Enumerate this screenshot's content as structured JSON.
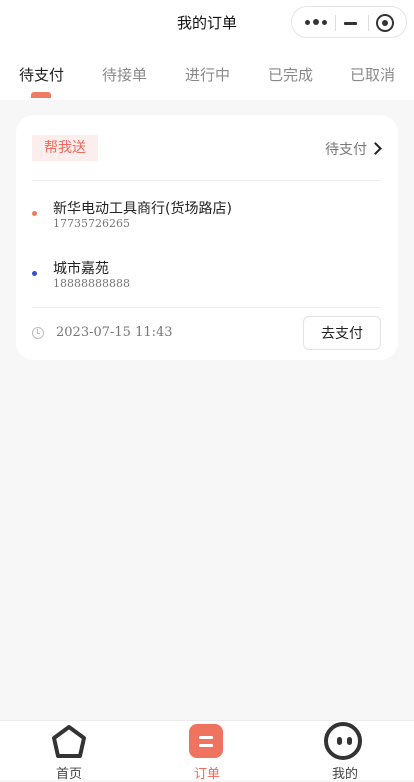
{
  "nav": {
    "title": "我的订单"
  },
  "tabs": [
    {
      "label": "待支付",
      "active": true
    },
    {
      "label": "待接单",
      "active": false
    },
    {
      "label": "进行中",
      "active": false
    },
    {
      "label": "已完成",
      "active": false
    },
    {
      "label": "已取消",
      "active": false
    }
  ],
  "order": {
    "type_badge": "帮我送",
    "status": "待支付",
    "pickup": {
      "name": "新华电动工具商行(货场路店)",
      "phone": "17735726265",
      "dot_color": "#f07a5e"
    },
    "dropoff": {
      "name": "城市嘉苑",
      "phone": "18888888888",
      "dot_color": "#3b4fd6"
    },
    "time": "2023-07-15 11:43",
    "pay_button": "去支付"
  },
  "bottom_nav": [
    {
      "label": "首页",
      "icon": "home-icon",
      "active": false
    },
    {
      "label": "订单",
      "icon": "order-icon",
      "active": true
    },
    {
      "label": "我的",
      "icon": "profile-icon",
      "active": false
    }
  ],
  "colors": {
    "accent": "#f0735f",
    "badge_bg": "#fdeeee",
    "background": "#f7f7f7"
  }
}
